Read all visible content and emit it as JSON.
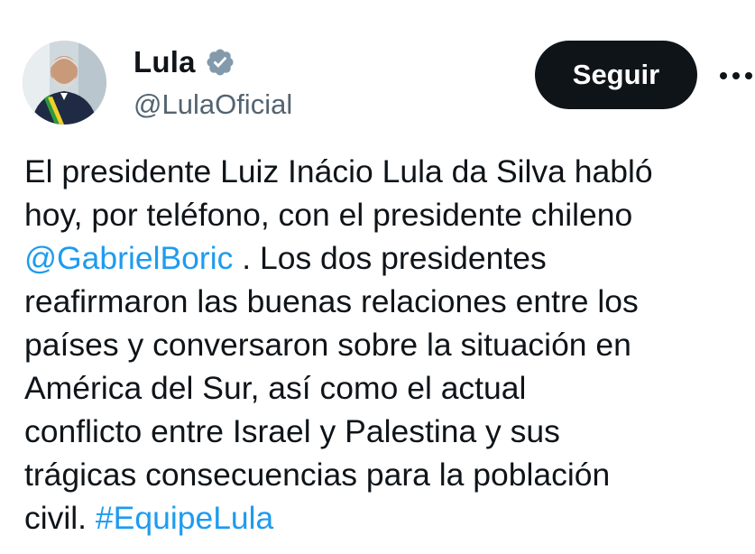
{
  "author": {
    "display_name": "Lula",
    "handle": "@LulaOficial",
    "verified": true,
    "avatar_icon": "profile-photo-avatar"
  },
  "actions": {
    "follow_label": "Seguir",
    "more_icon": "more-options-icon"
  },
  "tweet": {
    "line1": "El presidente Luiz Inácio Lula da Silva habló",
    "line2": "hoy, por teléfono, con el presidente chileno",
    "mention": "@GabrielBoric",
    "line3_rest": ". Los dos presidentes",
    "line4": "reafirmaron las buenas relaciones entre los",
    "line5": "países y conversaron sobre la situación en",
    "line6": "América del Sur, así como el actual",
    "line7": "conflicto entre Israel y Palestina y sus",
    "line8": "trágicas consecuencias para la población",
    "line9_start": "civil.",
    "hashtag": "#EquipeLula"
  },
  "colors": {
    "text": "#0f1419",
    "secondary": "#536471",
    "link": "#1d9bf0",
    "button_bg": "#0f1419",
    "verified_badge": "#829aab"
  }
}
